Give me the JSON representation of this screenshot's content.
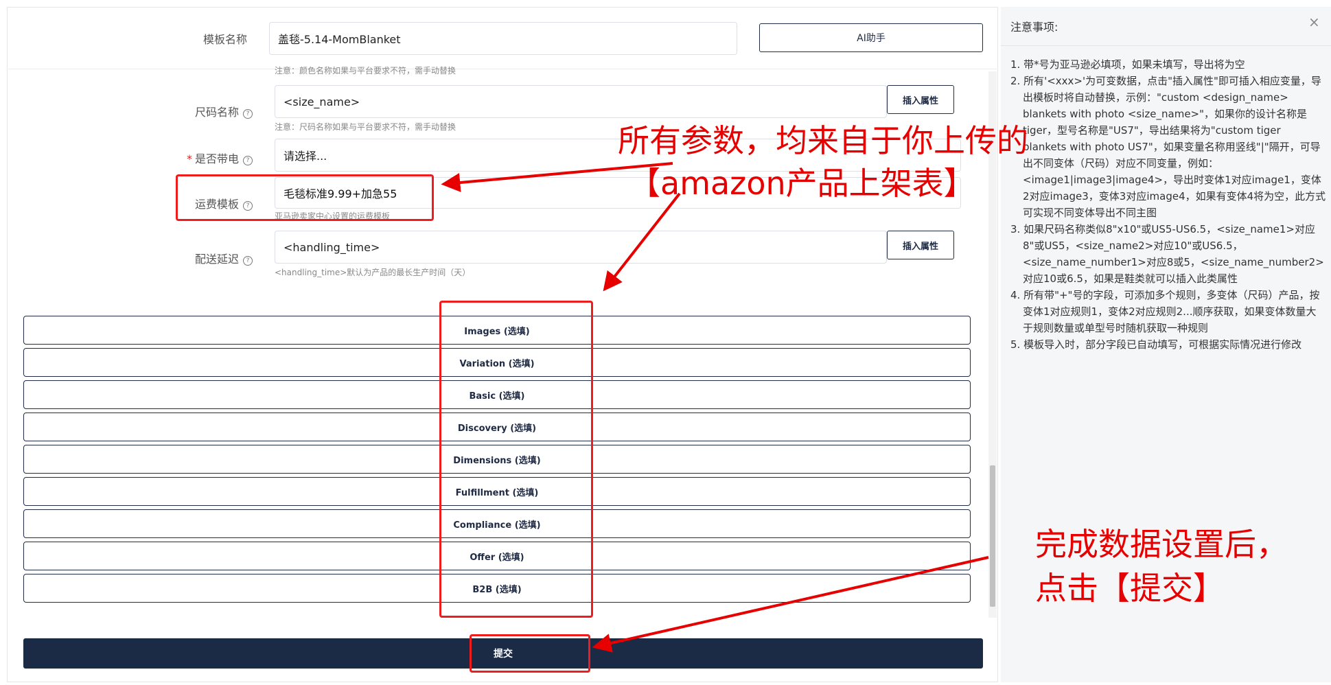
{
  "form": {
    "template_name": {
      "label": "模板名称",
      "value": "盖毯-5.14-MomBlanket"
    },
    "ai_button": "AI助手",
    "color_note": "注意：颜色名称如果与平台要求不符，需手动替换",
    "size_name": {
      "label": "尺码名称",
      "value": "<size_name>",
      "insert_label": "插入属性",
      "note": "注意：尺码名称如果与平台要求不符，需手动替换"
    },
    "battery": {
      "required_mark": "*",
      "label": "是否带电",
      "value": "请选择..."
    },
    "shipping_template": {
      "label": "运费模板",
      "value": "毛毯标准9.99+加急55",
      "note": "亚马逊卖家中心设置的运费模板"
    },
    "handling_time": {
      "label": "配送延迟",
      "value": "<handling_time>",
      "insert_label": "插入属性",
      "note": "<handling_time>默认为产品的最长生产时间（天）"
    },
    "sections": [
      "Images (选填)",
      "Variation (选填)",
      "Basic (选填)",
      "Discovery (选填)",
      "Dimensions (选填)",
      "Fulfillment (选填)",
      "Compliance (选填)",
      "Offer (选填)",
      "B2B (选填)"
    ],
    "submit": "提交",
    "help_glyph": "?"
  },
  "notes_panel": {
    "title": "注意事项:",
    "close": "×",
    "items": [
      "1. 带*号为亚马逊必填项，如果未填写，导出将为空",
      "2. 所有'<xxx>'为可变数据，点击\"插入属性\"即可插入相应变量，导出模板时将自动替换，示例：\"custom <design_name> blankets with photo <size_name>\"，如果你的设计名称是tiger，型号名称是\"US7\"，导出结果将为\"custom tiger blankets with photo US7\"，如果变量名称用竖线\"|\"隔开，可导出不同变体（尺码）对应不同变量，例如：<image1|image3|image4>，导出时变体1对应image1，变体2对应image3，变体3对应image4，如果有变体4将为空，此方式可实现不同变体导出不同主图",
      "3. 如果尺码名称类似8\"x10\"或US5-US6.5，<size_name1>对应8\"或US5，<size_name2>对应10\"或US6.5，<size_name_number1>对应8或5，<size_name_number2>对应10或6.5，如果是鞋类就可以插入此类属性",
      "4. 所有带\"+\"号的字段，可添加多个规则，多变体（尺码）产品，按变体1对应规则1，变体2对应规则2...顺序获取，如果变体数量大于规则数量或单型号时随机获取一种规则",
      "5. 模板导入时，部分字段已自动填写，可根据实际情况进行修改"
    ]
  },
  "annotations": {
    "params_line1": "所有参数，均来自于你上传的",
    "params_line2": "【amazon产品上架表】",
    "submit_line1": "完成数据设置后，",
    "submit_line2": "点击【提交】",
    "color": "#e60000"
  }
}
